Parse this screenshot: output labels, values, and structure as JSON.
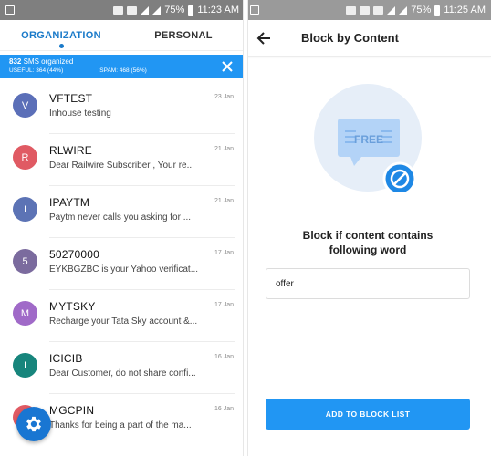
{
  "left": {
    "status_bar": {
      "battery": "75%",
      "time": "11:23 AM"
    },
    "tabs": [
      {
        "label": "ORGANIZATION",
        "active": true
      },
      {
        "label": "PERSONAL",
        "active": false
      }
    ],
    "banner": {
      "count": "832",
      "count_suffix": " SMS organized",
      "useful": "USEFUL: 364 (44%)",
      "spam": "SPAM: 468 (56%)"
    },
    "messages": [
      {
        "initial": "V",
        "sender": "VFTEST",
        "preview": "Inhouse testing",
        "date": "23 Jan",
        "color": "#5b6fb8"
      },
      {
        "initial": "R",
        "sender": "RLWIRE",
        "preview": "Dear Railwire Subscriber , Your re...",
        "date": "21 Jan",
        "color": "#e05a63"
      },
      {
        "initial": "I",
        "sender": "IPAYTM",
        "preview": "Paytm never calls you asking for ...",
        "date": "21 Jan",
        "color": "#5c73b5"
      },
      {
        "initial": "5",
        "sender": "50270000",
        "preview": "EYKBGZBC is your Yahoo verificat...",
        "date": "17 Jan",
        "color": "#7b6b9e"
      },
      {
        "initial": "M",
        "sender": "MYTSKY",
        "preview": "Recharge your Tata Sky account &...",
        "date": "17 Jan",
        "color": "#a06ac8"
      },
      {
        "initial": "I",
        "sender": "ICICIB",
        "preview": "Dear Customer, do not share confi...",
        "date": "16 Jan",
        "color": "#17857c"
      },
      {
        "initial": "M",
        "sender": "MGCPIN",
        "preview": "Thanks for being a part of the ma...",
        "date": "16 Jan",
        "color": "#e05a63"
      }
    ],
    "colors": {
      "accent": "#2196f3",
      "tab_active": "#1a7ac9"
    }
  },
  "right": {
    "status_bar": {
      "battery": "75%",
      "time": "11:25 AM"
    },
    "title": "Block by Content",
    "illustration_text": "FREE",
    "heading_line1": "Block if content contains",
    "heading_line2": "following word",
    "input_value": "offer",
    "button_label": "ADD TO BLOCK LIST",
    "colors": {
      "button": "#2196f3",
      "badge": "#1e88e5"
    }
  }
}
